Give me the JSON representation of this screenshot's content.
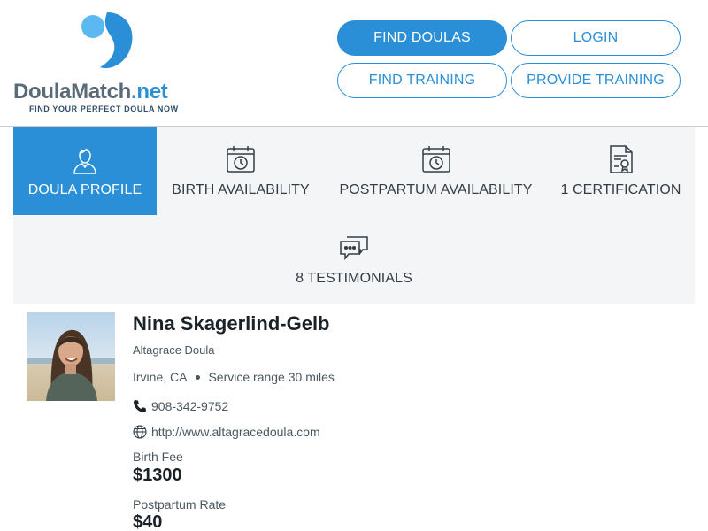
{
  "brand": {
    "name_part1": "Doula",
    "name_part2": "Match",
    "name_part3": ".net",
    "tagline": "FIND YOUR PERFECT DOULA NOW",
    "colors": {
      "accent": "#2a8fd6",
      "accent_light": "#5bb8f0",
      "text_gray": "#5a6a76"
    }
  },
  "nav": {
    "find_doulas": "FIND DOULAS",
    "login": "LOGIN",
    "find_training": "FIND TRAINING",
    "provide_training": "PROVIDE TRAINING"
  },
  "tabs": [
    {
      "label": "DOULA PROFILE",
      "icon": "doula-person-icon",
      "active": true
    },
    {
      "label": "BIRTH AVAILABILITY",
      "icon": "calendar-clock-icon",
      "active": false
    },
    {
      "label": "POSTPARTUM AVAILABILITY",
      "icon": "calendar-clock-icon",
      "active": false
    },
    {
      "label": "1 CERTIFICATION",
      "icon": "certificate-icon",
      "active": false
    },
    {
      "label": "8 TESTIMONIALS",
      "icon": "chat-bubbles-icon",
      "active": false
    }
  ],
  "profile": {
    "name": "Nina Skagerlind-Gelb",
    "agency": "Altagrace Doula",
    "city": "Irvine, CA",
    "service_range": "Service range 30 miles",
    "phone": "908-342-9752",
    "website": "http://www.altagracedoula.com",
    "birth_fee_label": "Birth Fee",
    "birth_fee": "$1300",
    "postpartum_rate_label": "Postpartum Rate",
    "postpartum_rate": "$40"
  }
}
